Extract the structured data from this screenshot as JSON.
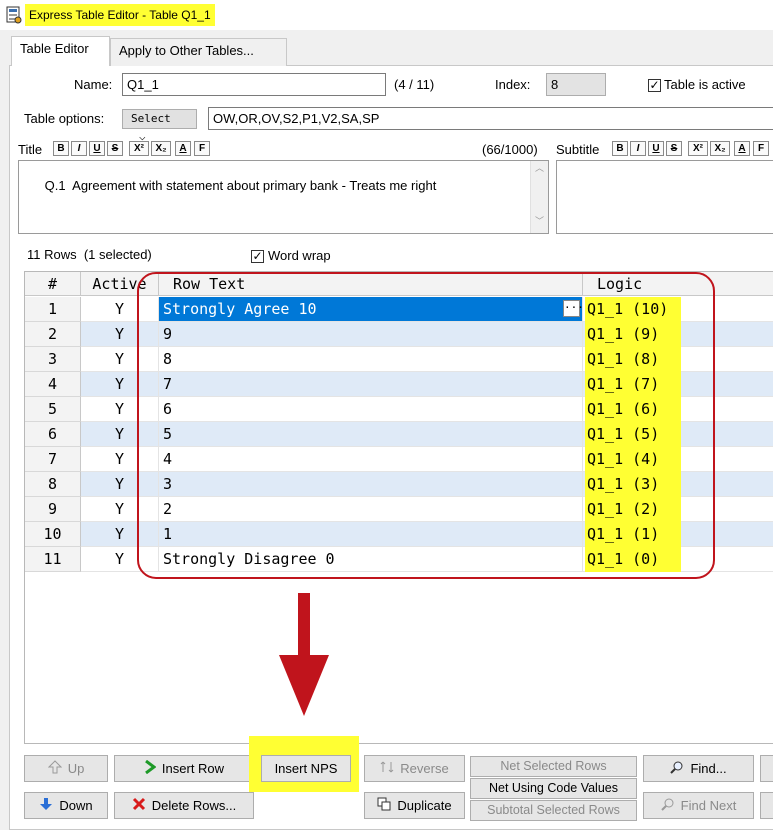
{
  "window": {
    "title": "Express Table Editor - Table Q1_1"
  },
  "tabs": [
    {
      "label": "Table Editor"
    },
    {
      "label": "Apply to Other Tables..."
    }
  ],
  "name_field": {
    "label": "Name:",
    "value": "Q1_1",
    "count": "(4 / 11)"
  },
  "index_field": {
    "label": "Index:",
    "value": "8"
  },
  "table_active": {
    "label": "Table is active",
    "checked": true
  },
  "table_options": {
    "label": "Table options:",
    "select_label": "Select",
    "value": "OW,OR,OV,S2,P1,V2,SA,SP"
  },
  "title_section": {
    "label": "Title",
    "count": "(66/1000)",
    "text": "    Q.1  Agreement with statement about primary bank - Treats me right"
  },
  "subtitle_section": {
    "label": "Subtitle"
  },
  "format_buttons": [
    "B",
    "I",
    "U",
    "S",
    "X²",
    "X₂",
    "A",
    "F"
  ],
  "rows_info": {
    "count_text": "11 Rows  (1 selected)",
    "word_wrap_label": "Word wrap"
  },
  "grid": {
    "columns": [
      "#",
      "Active",
      "Row Text",
      "Logic"
    ],
    "rows": [
      {
        "num": "1",
        "active": "Y",
        "text": "Strongly Agree 10",
        "logic": "Q1_1 (10)"
      },
      {
        "num": "2",
        "active": "Y",
        "text": "9",
        "logic": "Q1_1 (9)"
      },
      {
        "num": "3",
        "active": "Y",
        "text": "8",
        "logic": "Q1_1 (8)"
      },
      {
        "num": "4",
        "active": "Y",
        "text": "7",
        "logic": "Q1_1 (7)"
      },
      {
        "num": "5",
        "active": "Y",
        "text": "6",
        "logic": "Q1_1 (6)"
      },
      {
        "num": "6",
        "active": "Y",
        "text": "5",
        "logic": "Q1_1 (5)"
      },
      {
        "num": "7",
        "active": "Y",
        "text": "4",
        "logic": "Q1_1 (4)"
      },
      {
        "num": "8",
        "active": "Y",
        "text": "3",
        "logic": "Q1_1 (3)"
      },
      {
        "num": "9",
        "active": "Y",
        "text": "2",
        "logic": "Q1_1 (2)"
      },
      {
        "num": "10",
        "active": "Y",
        "text": "1",
        "logic": "Q1_1 (1)"
      },
      {
        "num": "11",
        "active": "Y",
        "text": "Strongly Disagree 0",
        "logic": "Q1_1 (0)"
      }
    ],
    "ellipsis_label": "···"
  },
  "buttons": {
    "up": "Up",
    "down": "Down",
    "insert_row": "Insert Row",
    "delete_rows": "Delete Rows...",
    "insert_nps": "Insert NPS",
    "reverse": "Reverse",
    "duplicate": "Duplicate",
    "net_selected": "Net Selected Rows",
    "net_code_values": "Net Using Code Values",
    "subtotal_selected": "Subtotal Selected Rows",
    "find": "Find...",
    "find_next": "Find Next"
  },
  "colors": {
    "highlight": "#ffff33",
    "selection": "#0078d7",
    "annotation_red": "#c0141c",
    "alt_row": "#dfeaf7"
  }
}
